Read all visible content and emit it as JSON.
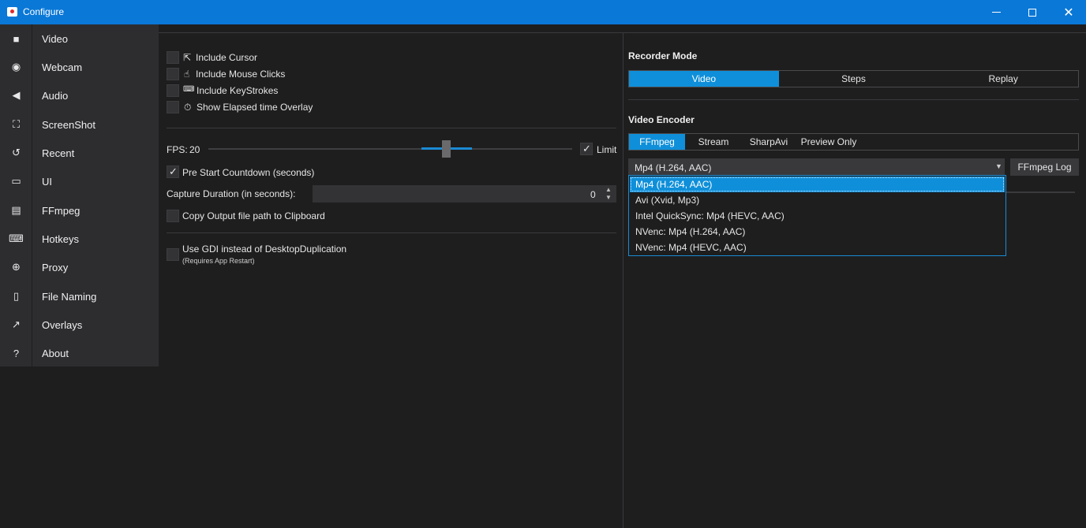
{
  "window": {
    "title": "Configure"
  },
  "sidebar": {
    "items": [
      {
        "label": "Video",
        "icon": "video-camera-icon",
        "glyph": "■"
      },
      {
        "label": "Webcam",
        "icon": "webcam-icon",
        "glyph": "◉"
      },
      {
        "label": "Audio",
        "icon": "speaker-icon",
        "glyph": "◀"
      },
      {
        "label": "ScreenShot",
        "icon": "screenshot-frame-icon",
        "glyph": "⛶"
      },
      {
        "label": "Recent",
        "icon": "history-icon",
        "glyph": "↺"
      },
      {
        "label": "UI",
        "icon": "window-icon",
        "glyph": "▭"
      },
      {
        "label": "FFmpeg",
        "icon": "file-icon",
        "glyph": "▤"
      },
      {
        "label": "Hotkeys",
        "icon": "keyboard-icon",
        "glyph": "⌨"
      },
      {
        "label": "Proxy",
        "icon": "globe-icon",
        "glyph": "⊕"
      },
      {
        "label": "File Naming",
        "icon": "document-icon",
        "glyph": "▯"
      },
      {
        "label": "Overlays",
        "icon": "arrow-up-right-icon",
        "glyph": "↗"
      },
      {
        "label": "About",
        "icon": "question-icon",
        "glyph": "?"
      }
    ]
  },
  "video": {
    "include_cursor": "Include Cursor",
    "include_mouse_clicks": "Include Mouse Clicks",
    "include_keystrokes": "Include KeyStrokes",
    "show_elapsed": "Show Elapsed time Overlay",
    "fps_label": "FPS:",
    "fps_value": "20",
    "limit_label": "Limit",
    "pre_start_countdown": "Pre Start Countdown (seconds)",
    "capture_duration_label": "Capture Duration (in seconds):",
    "capture_duration_value": "0",
    "copy_output_path": "Copy Output file path to Clipboard",
    "use_gdi": "Use GDI instead of DesktopDuplication",
    "requires_restart": "(Requires App Restart)"
  },
  "recorder_mode": {
    "title": "Recorder Mode",
    "options": [
      "Video",
      "Steps",
      "Replay"
    ],
    "selected": "Video"
  },
  "video_encoder": {
    "title": "Video Encoder",
    "tabs": [
      "FFmpeg",
      "Stream",
      "SharpAvi",
      "Preview Only"
    ],
    "selected_tab": "FFmpeg",
    "combo_value": "Mp4 (H.264, AAC)",
    "ffmpeg_log": "FFmpeg Log",
    "options": [
      "Mp4 (H.264, AAC)",
      "Avi (Xvid, Mp3)",
      "Intel QuickSync: Mp4 (HEVC, AAC)",
      "NVenc: Mp4 (H.264, AAC)",
      "NVenc: Mp4 (HEVC, AAC)"
    ]
  },
  "colors": {
    "accent": "#0f8fd9",
    "titlebar": "#0a78d7",
    "background": "#1e1e1f",
    "sidebar": "#2d2d30"
  }
}
